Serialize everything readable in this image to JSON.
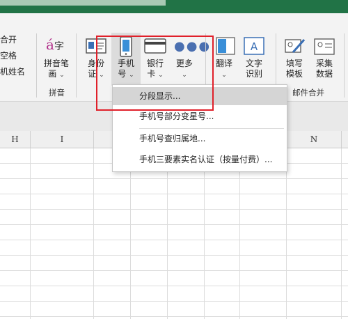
{
  "ribbon": {
    "left_partial": {
      "line1": "合开",
      "line2": "空格",
      "line3": "机姓名"
    },
    "pinyin": {
      "label_line1": "拼音笔",
      "label_line2": "画",
      "group_label": "拼音",
      "icon_text": "字"
    },
    "idcard": {
      "label_line1": "身份",
      "label_line2": "证"
    },
    "phone": {
      "label_line1": "手机",
      "label_line2": "号"
    },
    "bankcard": {
      "label_line1": "银行",
      "label_line2": "卡"
    },
    "more": {
      "label": "更多"
    },
    "translate": {
      "label": "翻译"
    },
    "ocr": {
      "label_line1": "文字",
      "label_line2": "识别",
      "icon_text": "A"
    },
    "fill_template": {
      "label_line1": "填写",
      "label_line2": "模板"
    },
    "collect_data": {
      "label_line1": "采集",
      "label_line2": "数据"
    },
    "mail_merge_group": "邮件合并"
  },
  "dropdown": {
    "items": [
      {
        "label": "分段显示..."
      },
      {
        "label": "手机号部分变星号..."
      },
      {
        "label": "手机号查归属地..."
      },
      {
        "label": "手机三要素实名认证（按量付费）..."
      }
    ]
  },
  "grid": {
    "columns": [
      "H",
      "I",
      "",
      "",
      "",
      "",
      "",
      "N",
      ""
    ]
  },
  "colors": {
    "title_bar": "#217346",
    "highlight_border": "#e0202a",
    "menu_highlight": "#d5d5d5"
  }
}
